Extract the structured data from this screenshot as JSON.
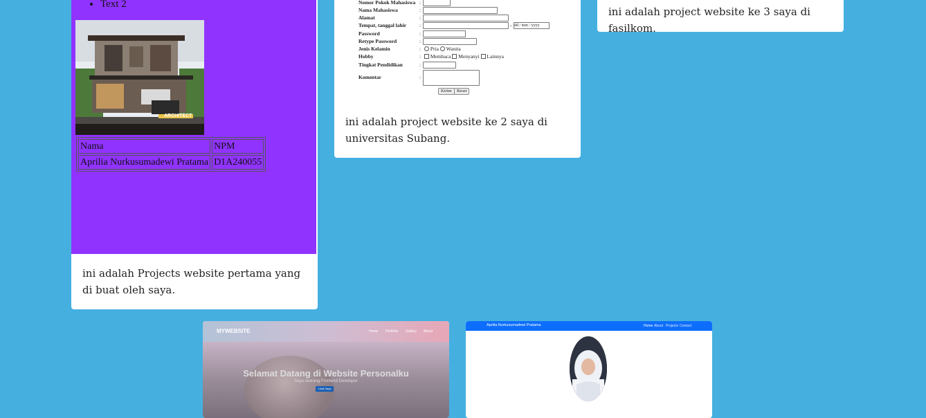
{
  "card1": {
    "list_item": "Text 2",
    "table": {
      "header": [
        "Nama",
        "NPM"
      ],
      "row": [
        "Aprilia Nurkusumadewi Pratama",
        "D1A240055"
      ]
    },
    "house_caption": "ARCHITECT",
    "description": "ini adalah Projects website pertama yang di buat oleh saya."
  },
  "card2": {
    "form": {
      "label_npm": "Nomor Pokok Mahasiswa",
      "label_nama": "Nama Mahasiswa",
      "label_alamat": "Alamat",
      "label_ttl": "Tempat, tanggal lahir",
      "date_placeholder": "dd / mm / yyyy",
      "label_password": "Password",
      "label_retype": "Retype Password",
      "label_gender": "Jenis Kelamin",
      "opt_pria": "Pria",
      "opt_wanita": "Wanita",
      "label_hobby": "Hobby",
      "opt_membaca": "Membaca",
      "opt_menyanyi": "Menyanyi",
      "opt_lainnya": "Lainnya",
      "label_pendidikan": "Tingkat Pendidikan",
      "label_komentar": "Komentar",
      "btn_kirim": "Kirim",
      "btn_reset": "Reset"
    },
    "description": "ini adalah project website ke 2 saya di universitas Subang."
  },
  "card3": {
    "description": "ini adalah project website ke 3 saya di fasilkom."
  },
  "card4": {
    "brand": "MYWEBSITE",
    "nav": [
      "Home",
      "Portfolio",
      "Gallery",
      "About"
    ],
    "hero_title": "Selamat Datang di Website Personalku",
    "hero_subtitle": "Saya seorang Frontend Developer",
    "hero_button": "Lihat Saya"
  },
  "card5": {
    "brand": "Aprilia Nurkusumadewi Pratama",
    "nav": [
      "Home",
      "About",
      "Projects",
      "Contact"
    ]
  },
  "colors": {
    "page_background": "#45b0e0",
    "purple_panel": "#9133ff",
    "bootstrap_blue": "#0d6efd"
  }
}
